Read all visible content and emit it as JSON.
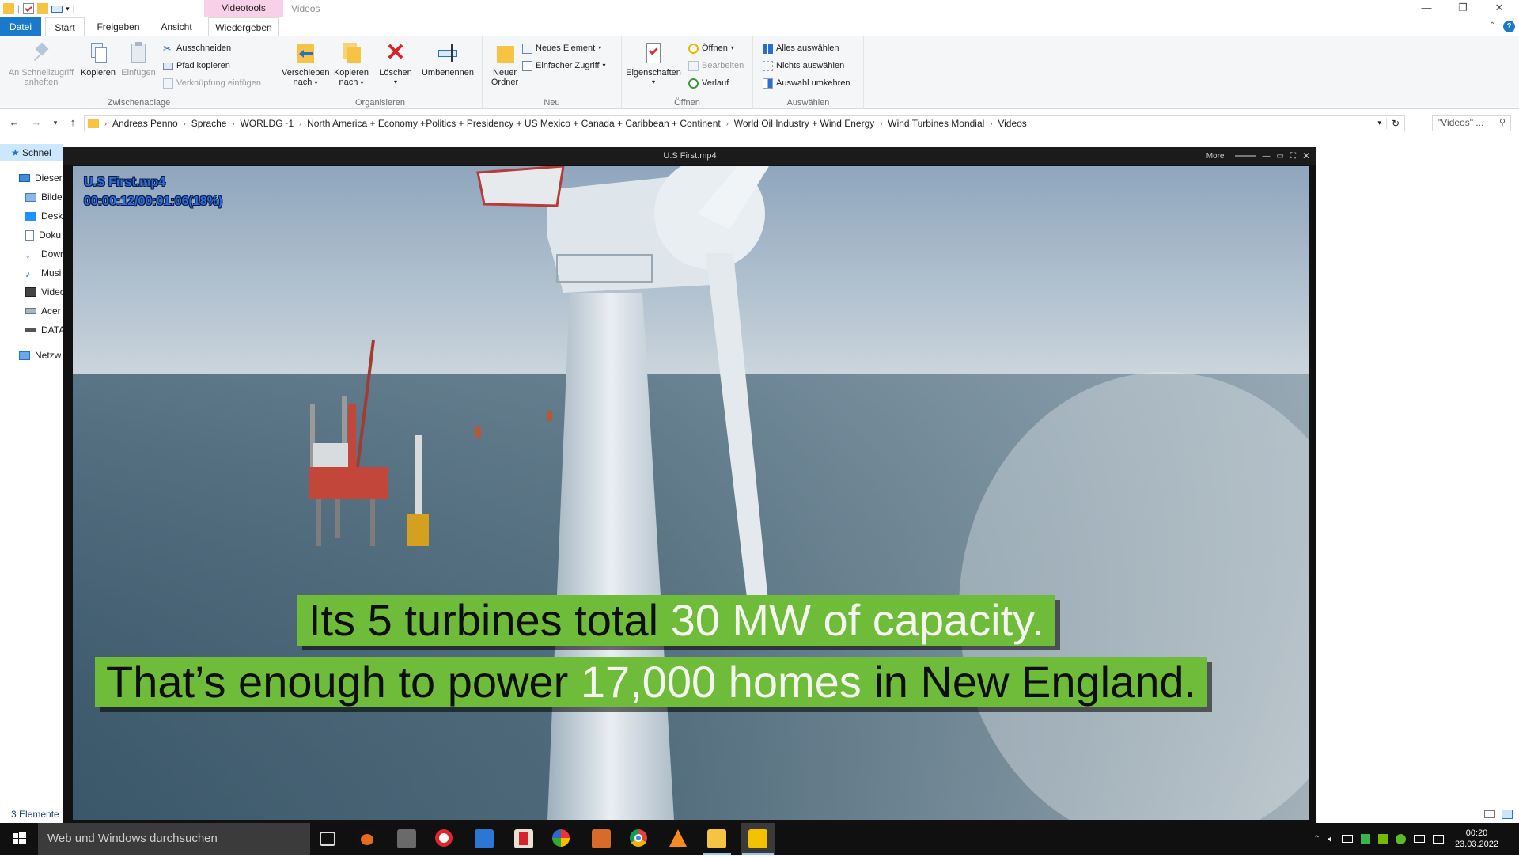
{
  "window": {
    "context_tab": "Videotools",
    "title": "Videos",
    "controls": {
      "minimize": "—",
      "maximize": "❐",
      "close": "✕"
    }
  },
  "ribbon_tabs": {
    "datei": "Datei",
    "start": "Start",
    "freigeben": "Freigeben",
    "ansicht": "Ansicht",
    "wiedergeben": "Wiedergeben"
  },
  "clipboard": {
    "pin": [
      "An Schnellzugriff",
      "anheften"
    ],
    "copy": "Kopieren",
    "paste": "Einfügen",
    "cut": "Ausschneiden",
    "copy_path": "Pfad kopieren",
    "paste_link": "Verknüpfung einfügen",
    "label": "Zwischenablage"
  },
  "organize": {
    "move": [
      "Verschieben",
      "nach"
    ],
    "copy_to": [
      "Kopieren",
      "nach"
    ],
    "delete": "Löschen",
    "rename": "Umbenennen",
    "label": "Organisieren"
  },
  "new_group": {
    "new_folder": [
      "Neuer",
      "Ordner"
    ],
    "new_item": "Neues Element",
    "easy_access": "Einfacher Zugriff",
    "label": "Neu"
  },
  "open_group": {
    "properties": "Eigenschaften",
    "open": "Öffnen",
    "edit": "Bearbeiten",
    "history": "Verlauf",
    "label": "Öffnen"
  },
  "select_group": {
    "select_all": "Alles auswählen",
    "select_none": "Nichts auswählen",
    "invert": "Auswahl umkehren",
    "label": "Auswählen"
  },
  "breadcrumb": [
    "Andreas Penno",
    "Sprache",
    "WORLDG~1",
    "North America + Economy +Politics + Presidency + US  Mexico + Canada + Caribbean + Continent",
    "World Oil Industry + Wind Energy",
    "Wind Turbines Mondial",
    "Videos"
  ],
  "search_placeholder": "\"Videos\" ...",
  "nav_pane": [
    "Schnel",
    "Dieser",
    "Bilde",
    "Desk",
    "Doku",
    "Dowr",
    "Musi",
    "Videc",
    "Acer",
    "DATA",
    "Netzw"
  ],
  "status": "3 Elemente",
  "player": {
    "title": "U.S First.mp4",
    "more": "More",
    "overlay_name": "U.S First.mp4",
    "overlay_time": "00:00:12/00:01:06(18%)",
    "caption1_a": "Its 5 turbines total",
    "caption1_b": "30 MW of capacity.",
    "caption2_a": "That’s enough to power",
    "caption2_b": "17,000 homes",
    "caption2_c": "in New England."
  },
  "taskbar": {
    "search_placeholder": "Web und Windows durchsuchen",
    "time": "00:20",
    "date": "23.03.2022"
  }
}
